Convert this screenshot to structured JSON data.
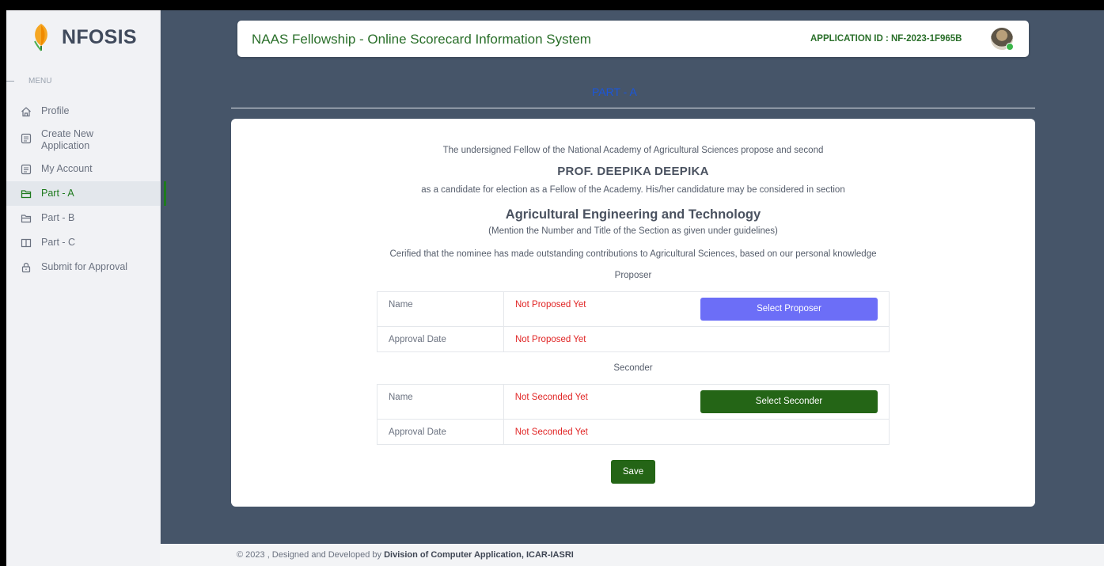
{
  "brand": {
    "name": "NFOSIS"
  },
  "sidebar": {
    "menu_heading": "MENU",
    "items": [
      {
        "label": "Profile",
        "icon": "home-icon"
      },
      {
        "label": "Create New Application",
        "icon": "document-icon"
      },
      {
        "label": "My Account",
        "icon": "document-icon"
      },
      {
        "label": "Part - A",
        "icon": "folder-icon",
        "active": true
      },
      {
        "label": "Part - B",
        "icon": "folder-icon"
      },
      {
        "label": "Part - C",
        "icon": "book-icon"
      },
      {
        "label": "Submit for Approval",
        "icon": "lock-icon"
      }
    ]
  },
  "header": {
    "title": "NAAS Fellowship - Online Scorecard Information System",
    "app_id": "APPLICATION ID : NF-2023-1F965B"
  },
  "page": {
    "section_title": "PART - A"
  },
  "card": {
    "intro": "The undersigned Fellow of the National Academy of Agricultural Sciences propose and second",
    "nominee": "PROF. DEEPIKA DEEPIKA",
    "candidacy": "as a candidate for election as a Fellow of the Academy. His/her candidature may be considered in section",
    "section": "Agricultural Engineering and Technology",
    "section_note": "(Mention the Number and Title of the Section as given under guidelines)",
    "certified": "Cerified that the nominee has made outstanding contributions to Agricultural Sciences, based on our personal knowledge",
    "proposer": {
      "heading": "Proposer",
      "name_label": "Name",
      "name_value": "Not Proposed Yet",
      "button": "Select Proposer",
      "date_label": "Approval Date",
      "date_value": "Not Proposed Yet"
    },
    "seconder": {
      "heading": "Seconder",
      "name_label": "Name",
      "name_value": "Not Seconded Yet",
      "button": "Select Seconder",
      "date_label": "Approval Date",
      "date_value": "Not Seconded Yet"
    },
    "save": "Save"
  },
  "footer": {
    "text": "© 2023 , Designed and Developed by ",
    "org": "Division of Computer Application, ICAR-IASRI"
  },
  "colors": {
    "accent_green": "#246516",
    "proposer_button": "#6c6ef7",
    "status_red": "#e02424",
    "section_blue": "#1a56db",
    "page_bg": "#465569"
  }
}
